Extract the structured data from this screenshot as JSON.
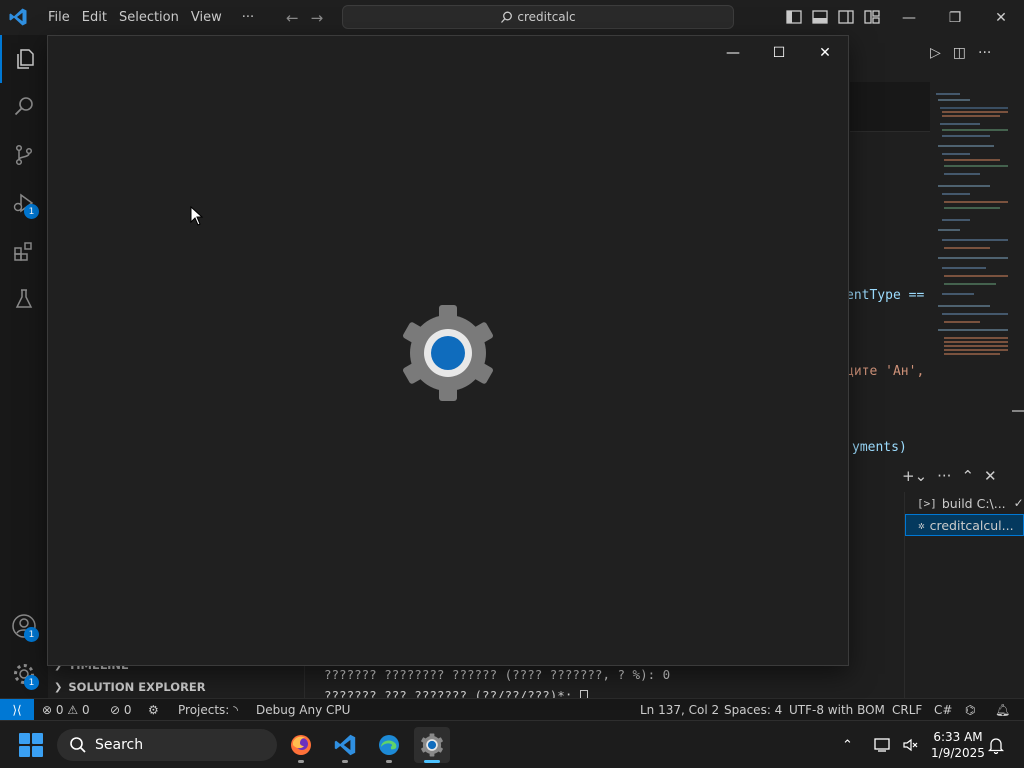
{
  "titlebar": {
    "menu": [
      "File",
      "Edit",
      "Selection",
      "View",
      "···"
    ],
    "command_center": "creditcalc"
  },
  "activitybar": {
    "run_debug_badge": "1",
    "accounts_badge": "1",
    "manage_badge": "1"
  },
  "editor_fragments": {
    "line1": "entType ==",
    "line2": "ците 'Ан',",
    "line3": "yments)"
  },
  "panel": {
    "terminals": [
      {
        "label": "build C:\\...",
        "icon": "terminal-icon",
        "status": "✓"
      },
      {
        "label": "creditcalcul...",
        "icon": "debug-icon",
        "status": ""
      }
    ],
    "output_lines": [
      "??????? ???????? ?????? (???? ???????, ? %): 0",
      "??????? ??? ??????? (??/??/???)*: "
    ]
  },
  "side_sections": [
    "TIMELINE",
    "SOLUTION EXPLORER"
  ],
  "statusbar": {
    "errors": "0",
    "warnings": "0",
    "ports": "0",
    "projects": "Projects:",
    "debug_config": "Debug Any CPU",
    "cursor_pos": "Ln 137, Col 2",
    "spaces": "Spaces: 4",
    "encoding": "UTF-8 with BOM",
    "eol": "CRLF",
    "language": "C#"
  },
  "taskbar": {
    "search_label": "Search",
    "time": "6:33 AM",
    "date": "1/9/2025"
  },
  "colors": {
    "accent": "#0078d4",
    "background": "#1f1f1f",
    "gear_center": "#0f6cbd"
  }
}
